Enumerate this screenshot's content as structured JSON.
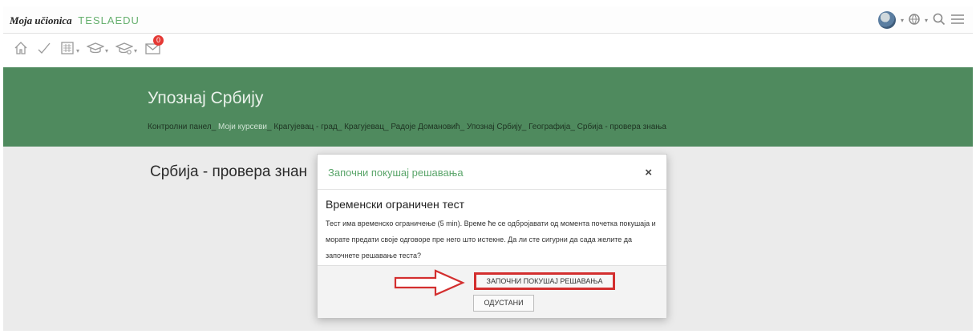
{
  "brand": {
    "name": "Moja učionica",
    "sub": "TESLAEDU"
  },
  "header": {
    "title": "Упознај Србију"
  },
  "breadcrumb": [
    "Контролни панел",
    "Моји курсеви",
    "Крагујевац - град",
    "Крагујевац",
    "Радоје Домановић",
    "Упознај Србију",
    "Географија",
    "Србија - провера знања"
  ],
  "breadcrumb_sep": "_",
  "page": {
    "title": "Србија - провера знан"
  },
  "navbar": {
    "mail_count": "0"
  },
  "modal": {
    "title": "Започни покушај решавања",
    "close_symbol": "×",
    "heading": "Временски ограничен тест",
    "body": "Тест има временско ограничење (5 min). Време ће се одбројавати од момента почетка покушаја и морате предати своје одговоре пре него што истекне. Да ли сте сигурни да сада желите да започнете решавање теста?",
    "start_button": "ЗАПОЧНИ ПОКУШАЈ РЕШАВАЊА",
    "cancel_button": "ОДУСТАНИ"
  },
  "colors": {
    "band_green": "#4f8a5e",
    "modal_title_green": "#5aa56a",
    "highlight_red": "#d32f2f",
    "badge_red": "#e53935"
  },
  "icons": [
    "home-icon",
    "check-icon",
    "calendar-icon",
    "graduation-cap-icon",
    "graduation-cap-settings-icon",
    "mail-icon",
    "avatar",
    "globe-icon",
    "search-icon",
    "menu-icon",
    "arrow-right-annotation-icon"
  ]
}
